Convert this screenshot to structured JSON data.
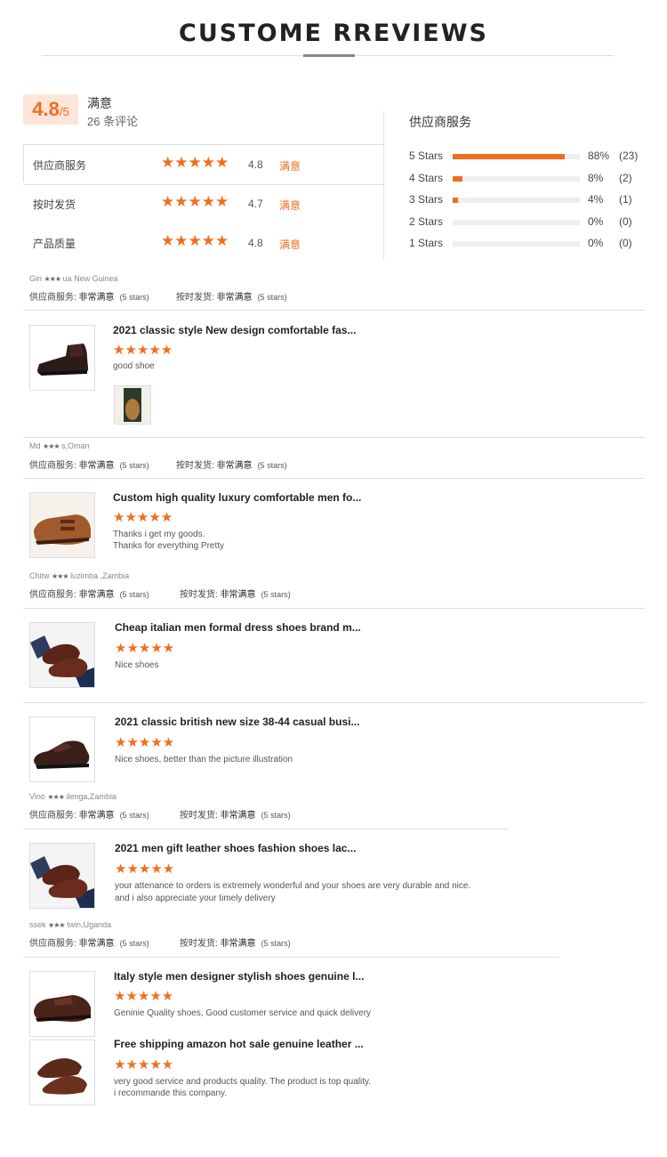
{
  "header": {
    "title": "CUSTOME  RREVIEWS"
  },
  "summary": {
    "score": "4.8",
    "score_max": "/5",
    "satisfaction": "满意",
    "review_count": "26 条评论"
  },
  "ratings": [
    {
      "label": "供应商服务",
      "stars": "★★★★★",
      "value": "4.8",
      "verdict": "满意"
    },
    {
      "label": "按时发货",
      "stars": "★★★★★",
      "value": "4.7",
      "verdict": "满意"
    },
    {
      "label": "产品质量",
      "stars": "★★★★★",
      "value": "4.8",
      "verdict": "满意"
    }
  ],
  "distribution": {
    "title": "供应商服务",
    "rows": [
      {
        "label": "5  Stars",
        "fraction": 0.88,
        "pct": "88%",
        "count": "(23)"
      },
      {
        "label": "4  Stars",
        "fraction": 0.08,
        "pct": "8%",
        "count": "(2)"
      },
      {
        "label": "3  Stars",
        "fraction": 0.04,
        "pct": "4%",
        "count": "(1)"
      },
      {
        "label": "2  Stars",
        "fraction": 0.0,
        "pct": "0%",
        "count": "(0)"
      },
      {
        "label": "1  Stars",
        "fraction": 0.0,
        "pct": "0%",
        "count": "(0)"
      }
    ]
  },
  "service_labels": {
    "supplier": "供应商服务:",
    "ontime": "按时发货:",
    "very_satisfied": "非常满意",
    "five_stars": "(5 stars)",
    "mini_stars": "★★★"
  },
  "reviewers": [
    {
      "name": "Gin",
      "location": "ua New Guinea"
    },
    {
      "name": "Md",
      "location": "s,Oman"
    },
    {
      "name": "Chitw",
      "location": "luzimba ,Zambia"
    },
    {
      "name": "Vino",
      "location": "ilenga,Zambia"
    },
    {
      "name": "ssek",
      "location": "twin,Uganda"
    }
  ],
  "reviews": [
    {
      "title": "2021 classic style New design comfortable fas...",
      "stars": "★★★★★",
      "text": "good shoe",
      "thumb": "chelsea-boot-icon"
    },
    {
      "title": "Custom high quality luxury comfortable men fo...",
      "stars": "★★★★★",
      "text": "Thanks i get my goods.",
      "text2": "Thanks for everything Pretty",
      "thumb": "monk-strap-shoe-icon"
    },
    {
      "title": "Cheap italian men formal dress shoes brand m...",
      "stars": "★★★★★",
      "text": "Nice shoes",
      "thumb": "oxford-shoes-pair-icon"
    },
    {
      "title": "2021 classic british new size 38-44 casual busi...",
      "stars": "★★★★★",
      "text": "Nice shoes, better than the picture illustration",
      "thumb": "oxford-shoe-icon"
    },
    {
      "title": "2021 men gift leather shoes fashion shoes lac...",
      "stars": "★★★★★",
      "text": "your attenance to orders is extremely wonderful and your shoes are very durable and nice.",
      "text2": "and i also appreciate your timely delivery",
      "thumb": "oxford-shoes-pair-icon"
    },
    {
      "title": "Italy style men designer stylish shoes genuine l...",
      "stars": "★★★★★",
      "text": "Geninie Quality shoes, Good customer service and quick delivery",
      "thumb": "derby-shoe-icon"
    },
    {
      "title": "Free shipping amazon hot sale genuine leather ...",
      "stars": "★★★★★",
      "text": "very good service and products quality. The product is top quality.",
      "text2": "i recommande this company.",
      "thumb": "brogue-shoes-pair-icon"
    }
  ],
  "colors": {
    "accent": "#f06e1d",
    "score_bg": "#fde6d8",
    "divider": "#dddddd"
  }
}
